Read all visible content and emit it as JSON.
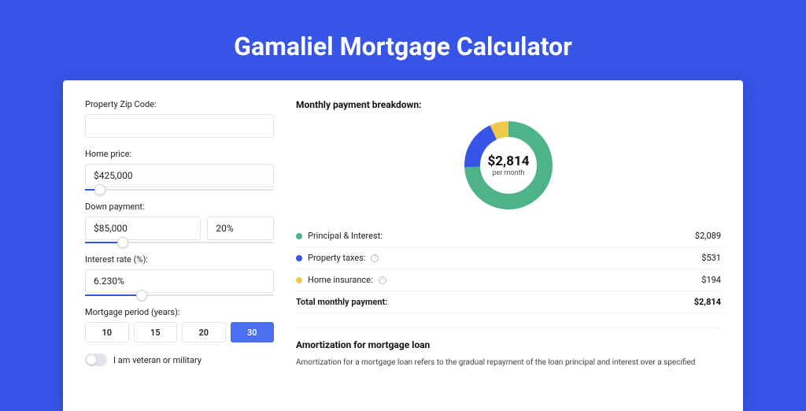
{
  "page": {
    "title": "Gamaliel Mortgage Calculator"
  },
  "colors": {
    "green": "#4fb38a",
    "blue": "#3654e6",
    "yellow": "#f0c94a"
  },
  "form": {
    "zip": {
      "label": "Property Zip Code:",
      "value": ""
    },
    "home_price": {
      "label": "Home price:",
      "value": "$425,000",
      "slider_pct": 8
    },
    "down_payment": {
      "label": "Down payment:",
      "value": "$85,000",
      "pct": "20%",
      "slider_pct": 20
    },
    "interest": {
      "label": "Interest rate (%):",
      "value": "6.230%",
      "slider_pct": 30
    },
    "period": {
      "label": "Mortgage period (years):",
      "options": [
        "10",
        "15",
        "20",
        "30"
      ],
      "active": "30"
    },
    "veteran": {
      "label": "I am veteran or military",
      "on": false
    }
  },
  "breakdown": {
    "title": "Monthly payment breakdown:",
    "center_amount": "$2,814",
    "center_sub": "per month",
    "items": [
      {
        "label": "Principal & Interest:",
        "value": "$2,089",
        "color": "#4fb38a",
        "info": false
      },
      {
        "label": "Property taxes:",
        "value": "$531",
        "color": "#3654e6",
        "info": true
      },
      {
        "label": "Home insurance:",
        "value": "$194",
        "color": "#f0c94a",
        "info": true
      }
    ],
    "total": {
      "label": "Total monthly payment:",
      "value": "$2,814"
    }
  },
  "chart_data": {
    "type": "pie",
    "title": "Monthly payment breakdown",
    "series": [
      {
        "name": "Principal & Interest",
        "value": 2089,
        "color": "#4fb38a"
      },
      {
        "name": "Property taxes",
        "value": 531,
        "color": "#3654e6"
      },
      {
        "name": "Home insurance",
        "value": 194,
        "color": "#f0c94a"
      }
    ],
    "total": 2814
  },
  "amort": {
    "title": "Amortization for mortgage loan",
    "text": "Amortization for a mortgage loan refers to the gradual repayment of the loan principal and interest over a specified"
  }
}
